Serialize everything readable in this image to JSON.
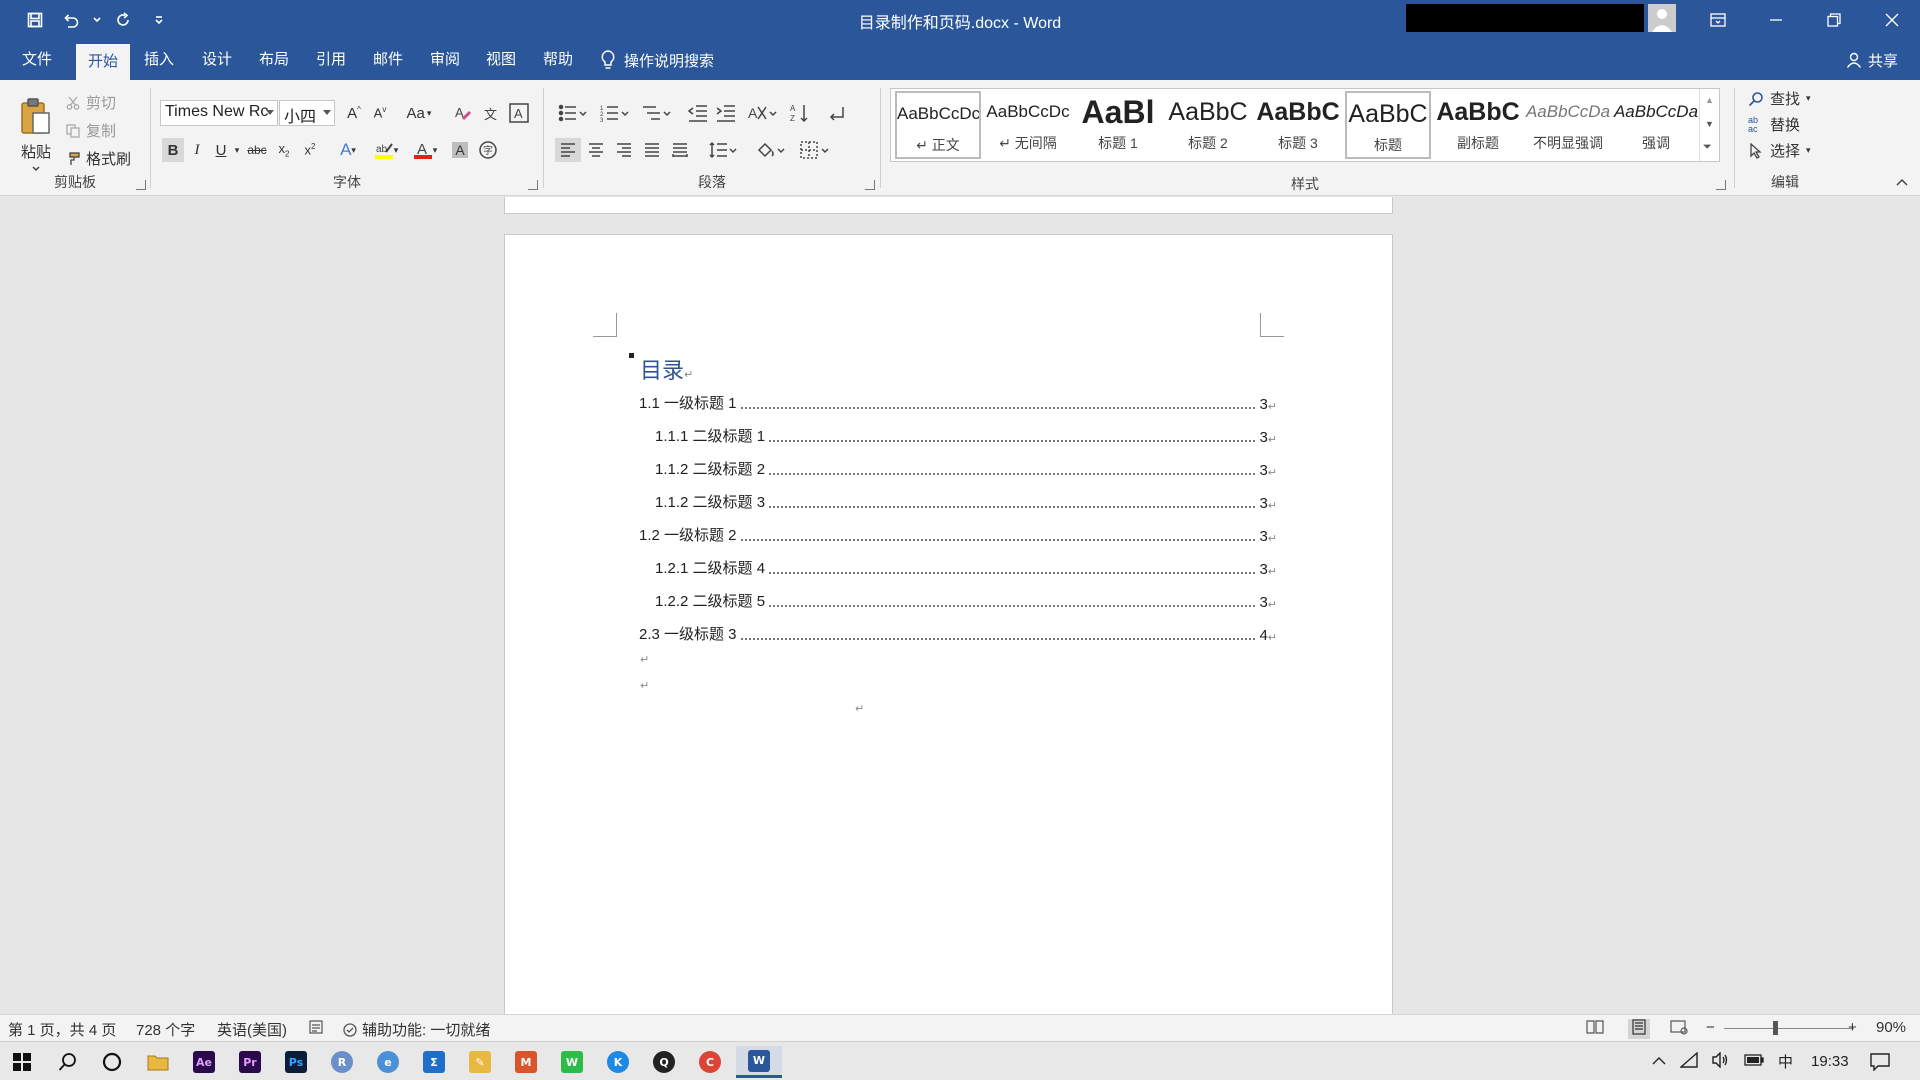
{
  "window": {
    "title": "目录制作和页码.docx  -  Word"
  },
  "ribbon_tabs": [
    {
      "label": "文件"
    },
    {
      "label": "开始"
    },
    {
      "label": "插入"
    },
    {
      "label": "设计"
    },
    {
      "label": "布局"
    },
    {
      "label": "引用"
    },
    {
      "label": "邮件"
    },
    {
      "label": "审阅"
    },
    {
      "label": "视图"
    },
    {
      "label": "帮助"
    }
  ],
  "tell_me": "操作说明搜索",
  "share": "共享",
  "clipboard": {
    "paste": "粘贴",
    "cut": "剪切",
    "copy": "复制",
    "format_painter": "格式刷",
    "group_label": "剪贴板"
  },
  "font": {
    "name": "Times New Rc",
    "size": "小四",
    "case_label": "Aa",
    "group_label": "字体",
    "color_accent": "#e02020",
    "highlight_color": "#ffff00"
  },
  "paragraph": {
    "group_label": "段落"
  },
  "styles": {
    "group_label": "样式",
    "items": [
      {
        "preview": "AaBbCcDc",
        "name": "↵ 正文"
      },
      {
        "preview": "AaBbCcDc",
        "name": "↵ 无间隔"
      },
      {
        "preview": "AaBl",
        "name": "标题 1"
      },
      {
        "preview": "AaBbC",
        "name": "标题 2"
      },
      {
        "preview": "AaBbC",
        "name": "标题 3"
      },
      {
        "preview": "AaBbC",
        "name": "标题"
      },
      {
        "preview": "AaBbC",
        "name": "副标题"
      },
      {
        "preview": "AaBbCcDa",
        "name": "不明显强调"
      },
      {
        "preview": "AaBbCcDa",
        "name": "强调"
      }
    ]
  },
  "editing": {
    "find": "查找",
    "replace": "替换",
    "select": "选择",
    "group_label": "编辑"
  },
  "document": {
    "toc_heading": "目录",
    "entries": [
      {
        "text": "1.1 一级标题 1",
        "page": "3",
        "level": 1
      },
      {
        "text": "1.1.1 二级标题 1",
        "page": "3",
        "level": 2
      },
      {
        "text": "1.1.2 二级标题 2",
        "page": "3",
        "level": 2
      },
      {
        "text": "1.1.2 二级标题 3",
        "page": "3",
        "level": 2
      },
      {
        "text": "1.2 一级标题 2",
        "page": "3",
        "level": 1
      },
      {
        "text": "1.2.1 二级标题 4",
        "page": "3",
        "level": 2
      },
      {
        "text": "1.2.2 二级标题 5",
        "page": "3",
        "level": 2
      },
      {
        "text": "2.3 一级标题 3",
        "page": "4",
        "level": 1
      }
    ],
    "para_mark": "↵"
  },
  "status": {
    "page": "第 1 页，共 4 页",
    "words": "728 个字",
    "language": "英语(美国)",
    "accessibility": "辅助功能: 一切就绪",
    "zoom": "90%"
  },
  "taskbar": {
    "ime": "中",
    "time": "19:33",
    "apps": [
      {
        "name": "ae",
        "label": "Ae",
        "color": "#2a0a4a"
      },
      {
        "name": "pr",
        "label": "Pr",
        "color": "#2a0a4a"
      },
      {
        "name": "ps",
        "label": "Ps",
        "color": "#0a1e3a"
      },
      {
        "name": "r",
        "label": "R",
        "color": "#6a8fc9"
      },
      {
        "name": "browser",
        "label": "e",
        "color": "#4b8fd8"
      },
      {
        "name": "sigma",
        "label": "Σ",
        "color": "#1f6fc9"
      },
      {
        "name": "paint",
        "label": "✎",
        "color": "#e8b840"
      },
      {
        "name": "matlab",
        "label": "M",
        "color": "#d9542b"
      },
      {
        "name": "wechat",
        "label": "W",
        "color": "#2dbb4a"
      },
      {
        "name": "k",
        "label": "K",
        "color": "#1e88e5"
      },
      {
        "name": "qq",
        "label": "Q",
        "color": "#222222"
      },
      {
        "name": "chrome",
        "label": "C",
        "color": "#db4437"
      },
      {
        "name": "word",
        "label": "W",
        "color": "#2b579a"
      }
    ]
  }
}
